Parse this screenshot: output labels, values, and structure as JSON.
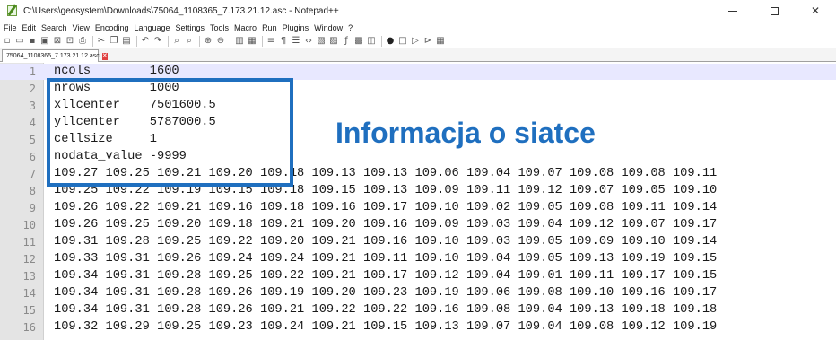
{
  "window": {
    "title": "C:\\Users\\geosystem\\Downloads\\75064_1108365_7.173.21.12.asc - Notepad++",
    "minimize_glyph": "—",
    "maximize_glyph": "☐",
    "close_glyph": "✕"
  },
  "menu": [
    "File",
    "Edit",
    "Search",
    "View",
    "Encoding",
    "Language",
    "Settings",
    "Tools",
    "Macro",
    "Run",
    "Plugins",
    "Window",
    "?"
  ],
  "toolbar": {
    "icons": [
      "new-file-icon",
      "open-file-icon",
      "save-icon",
      "save-all-icon",
      "close-icon",
      "close-all-icon",
      "print-icon",
      "cut-icon",
      "copy-icon",
      "paste-icon",
      "undo-icon",
      "redo-icon",
      "find-icon",
      "replace-icon",
      "zoom-in-icon",
      "zoom-out-icon",
      "sync-v-icon",
      "sync-h-icon",
      "wrap-icon",
      "show-all-chars-icon",
      "indent-guide-icon",
      "xml-icon",
      "doc-map-icon",
      "function-list-icon",
      "fx-icon",
      "monitor-icon",
      "folder-workspace-icon",
      "record-macro-icon",
      "stop-macro-icon",
      "play-macro-icon",
      "run-macro-multiple-icon",
      "save-macro-icon"
    ]
  },
  "tab": {
    "label": "75064_1108365_7.173.21.12.asc",
    "close_glyph": "✕"
  },
  "editor": {
    "lines": [
      "ncols        1600",
      "nrows        1000",
      "xllcenter    7501600.5",
      "yllcenter    5787000.5",
      "cellsize     1",
      "nodata_value -9999",
      "109.27 109.25 109.21 109.20 109.18 109.13 109.13 109.06 109.04 109.07 109.08 109.08 109.11",
      "109.25 109.22 109.19 109.15 109.18 109.15 109.13 109.09 109.11 109.12 109.07 109.05 109.10",
      "109.26 109.22 109.21 109.16 109.18 109.16 109.17 109.10 109.02 109.05 109.08 109.11 109.14",
      "109.26 109.25 109.20 109.18 109.21 109.20 109.16 109.09 109.03 109.04 109.12 109.07 109.17",
      "109.31 109.28 109.25 109.22 109.20 109.21 109.16 109.10 109.03 109.05 109.09 109.10 109.14",
      "109.33 109.31 109.26 109.24 109.24 109.21 109.11 109.10 109.04 109.05 109.13 109.19 109.15",
      "109.34 109.31 109.28 109.25 109.22 109.21 109.17 109.12 109.04 109.01 109.11 109.17 109.15",
      "109.34 109.31 109.28 109.26 109.19 109.20 109.23 109.19 109.06 109.08 109.10 109.16 109.17",
      "109.34 109.31 109.28 109.26 109.21 109.22 109.22 109.16 109.08 109.04 109.13 109.18 109.18",
      "109.32 109.29 109.25 109.23 109.24 109.21 109.15 109.13 109.07 109.04 109.08 109.12 109.19"
    ],
    "line_numbers": [
      "1",
      "2",
      "3",
      "4",
      "5",
      "6",
      "7",
      "8",
      "9",
      "10",
      "11",
      "12",
      "13",
      "14",
      "15",
      "16"
    ]
  },
  "annotation": {
    "text": "Informacja o siatce",
    "color": "#1f6fbf"
  }
}
